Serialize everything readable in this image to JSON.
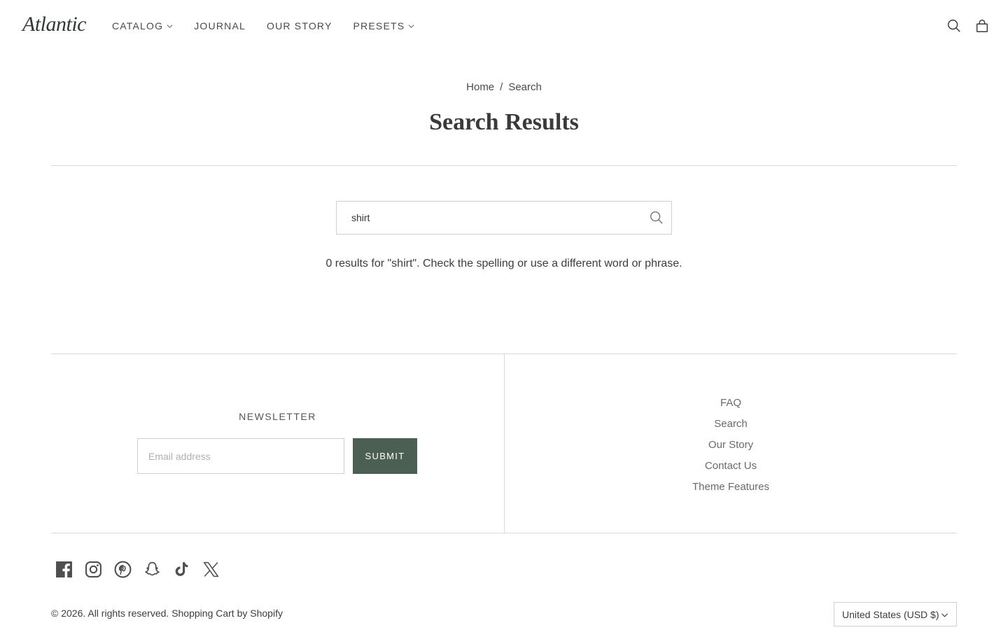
{
  "header": {
    "logo": "Atlantic",
    "nav": [
      {
        "label": "CATALOG",
        "dropdown": true
      },
      {
        "label": "JOURNAL",
        "dropdown": false
      },
      {
        "label": "OUR STORY",
        "dropdown": false
      },
      {
        "label": "PRESETS",
        "dropdown": true
      }
    ],
    "icons": [
      "search-icon",
      "cart-bag-icon"
    ]
  },
  "breadcrumb": {
    "home": "Home",
    "separator": "/",
    "current": "Search"
  },
  "page_title": "Search Results",
  "search": {
    "value": "shirt",
    "result_message": "0 results for \"shirt\". Check the spelling or use a different word or phrase."
  },
  "footer": {
    "newsletter_title": "NEWSLETTER",
    "email_placeholder": "Email address",
    "submit_label": "SUBMIT",
    "links": [
      "FAQ",
      "Search",
      "Our Story",
      "Contact Us",
      "Theme Features"
    ],
    "socials": [
      "facebook-icon",
      "instagram-icon",
      "pinterest-icon",
      "snapchat-icon",
      "tiktok-icon",
      "x-icon"
    ],
    "copyright": "© 2026. All rights reserved.",
    "shopify_link": "Shopping Cart by Shopify",
    "currency": "United States (USD $)"
  },
  "colors": {
    "accent": "#4b5f53",
    "text": "#3d3d3d",
    "border": "#d9d9d9"
  }
}
